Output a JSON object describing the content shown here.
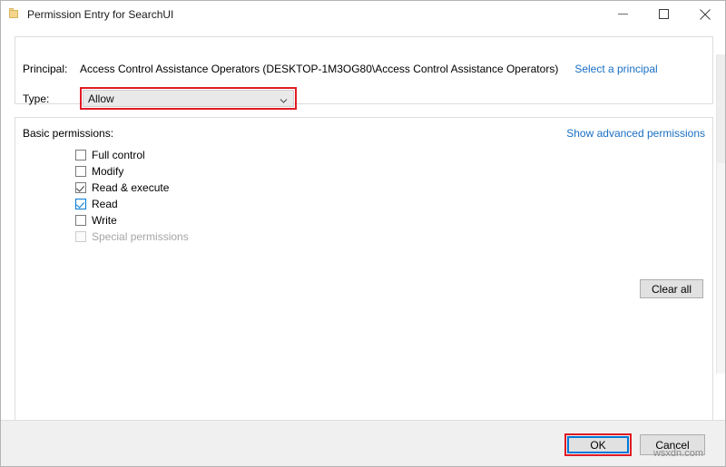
{
  "window": {
    "title": "Permission Entry for SearchUI",
    "icon": "folder-icon",
    "controls": {
      "minimize": "minimize-icon",
      "maximize": "maximize-icon",
      "close": "close-icon"
    }
  },
  "principal": {
    "label": "Principal:",
    "value": "Access Control Assistance Operators (DESKTOP-1M3OG80\\Access Control Assistance Operators)",
    "link": "Select a principal"
  },
  "type": {
    "label": "Type:",
    "value": "Allow",
    "highlight_color": "#e01b24"
  },
  "permissions": {
    "header": "Basic permissions:",
    "advanced_link": "Show advanced permissions",
    "items": [
      {
        "label": "Full control",
        "state": "unchecked",
        "disabled": false
      },
      {
        "label": "Modify",
        "state": "unchecked",
        "disabled": false
      },
      {
        "label": "Read & execute",
        "state": "checked",
        "disabled": false
      },
      {
        "label": "Read",
        "state": "checked-hot",
        "disabled": false
      },
      {
        "label": "Write",
        "state": "unchecked",
        "disabled": false
      },
      {
        "label": "Special permissions",
        "state": "unchecked",
        "disabled": true
      }
    ],
    "clear_all": "Clear all"
  },
  "footer": {
    "ok": "OK",
    "cancel": "Cancel",
    "watermark": "wsxdn.com",
    "ok_focus_color": "#0078d7",
    "ok_highlight_color": "#e01b24"
  }
}
